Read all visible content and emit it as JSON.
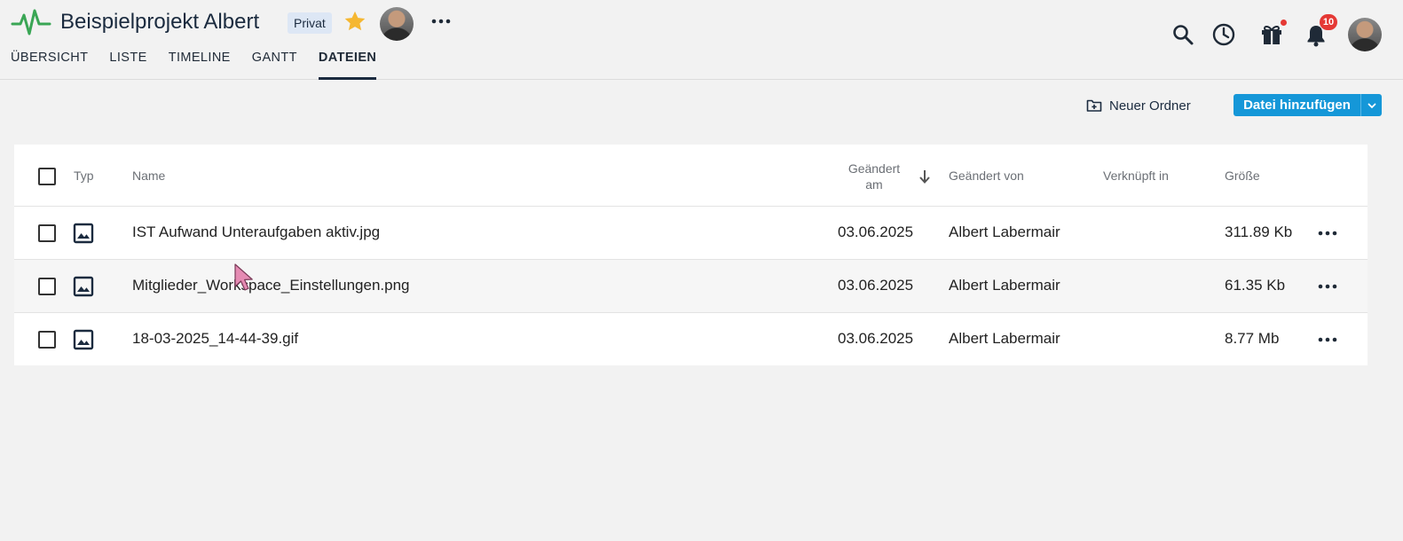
{
  "header": {
    "project_title": "Beispielprojekt Albert",
    "privacy_badge": "Privat",
    "tabs": [
      {
        "label": "ÜBERSICHT",
        "active": false
      },
      {
        "label": "LISTE",
        "active": false
      },
      {
        "label": "TIMELINE",
        "active": false
      },
      {
        "label": "GANTT",
        "active": false
      },
      {
        "label": "DATEIEN",
        "active": true
      }
    ],
    "notification_count": "10",
    "icons": [
      "pulse-logo-icon",
      "star-icon",
      "more-icon",
      "search-icon",
      "clock-icon",
      "gift-icon",
      "bell-icon"
    ]
  },
  "toolbar": {
    "new_folder_label": "Neuer Ordner",
    "add_file_label": "Datei hinzufügen"
  },
  "table": {
    "columns": {
      "type": "Typ",
      "name": "Name",
      "modified_at": "Geändert am",
      "modified_by": "Geändert von",
      "linked_in": "Verknüpft in",
      "size": "Größe"
    },
    "sort": {
      "column": "modified_at",
      "direction": "desc"
    },
    "rows": [
      {
        "name": "IST Aufwand Unteraufgaben aktiv.jpg",
        "modified_at": "03.06.2025",
        "modified_by": "Albert Labermair",
        "linked_in": "",
        "size": "311.89 Kb"
      },
      {
        "name": "Mitglieder_Workspace_Einstellungen.png",
        "modified_at": "03.06.2025",
        "modified_by": "Albert Labermair",
        "linked_in": "",
        "size": "61.35 Kb"
      },
      {
        "name": "18-03-2025_14-44-39.gif",
        "modified_at": "03.06.2025",
        "modified_by": "Albert Labermair",
        "linked_in": "",
        "size": "8.77 Mb"
      }
    ]
  },
  "colors": {
    "accent": "#1597d8",
    "logo_green": "#3aa655",
    "star": "#f5b731",
    "badge_red": "#e53935",
    "nav_dark": "#1b2b3f"
  }
}
